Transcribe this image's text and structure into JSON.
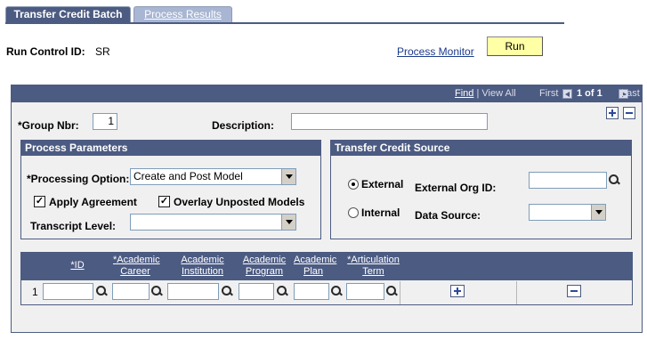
{
  "tabs": [
    {
      "label": "Transfer Credit Batch",
      "active": true
    },
    {
      "label": "Process Results",
      "active": false
    }
  ],
  "header": {
    "run_control_label": "Run Control ID:",
    "run_control_value": "SR",
    "process_monitor_label": "Process Monitor",
    "run_label": "Run"
  },
  "nav": {
    "find": "Find",
    "view_all": "View All",
    "first": "First",
    "position": "1 of 1",
    "last": "Last"
  },
  "group": {
    "group_nbr_label": "*Group Nbr:",
    "group_nbr_value": "1",
    "description_label": "Description:",
    "description_value": ""
  },
  "process_parameters": {
    "title": "Process Parameters",
    "processing_option_label": "*Processing Option:",
    "processing_option_value": "Create and Post Model",
    "apply_agreement_label": "Apply Agreement",
    "apply_agreement_checked": true,
    "overlay_label": "Overlay Unposted Models",
    "overlay_checked": true,
    "transcript_level_label": "Transcript Level:",
    "transcript_level_value": ""
  },
  "transfer_source": {
    "title": "Transfer Credit Source",
    "external_label": "External",
    "internal_label": "Internal",
    "selected": "External",
    "external_org_label": "External Org ID:",
    "external_org_value": "",
    "data_source_label": "Data Source:",
    "data_source_value": ""
  },
  "grid": {
    "columns": [
      "*ID",
      "*Academic Career",
      "Academic Institution",
      "Academic Program",
      "Academic Plan",
      "*Articulation Term"
    ],
    "rows": [
      {
        "num": "1"
      }
    ]
  },
  "colors": {
    "header_blue": "#4c5b82",
    "run_button": "#ffffa5",
    "panel_bg": "#f1f0f0",
    "link": "#1c3b8b"
  }
}
